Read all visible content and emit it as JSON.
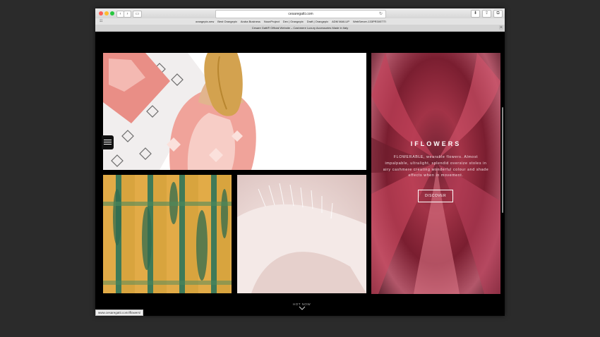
{
  "browser": {
    "url": "cesaregatti.com",
    "bookmarks": [
      "orangepix-new",
      "Best Orangepix",
      "Aruba Business",
      "NounProject",
      "Dev | Orangepix",
      "Draft | Orangepix",
      "ADM MAILUP",
      "WebServer-133PR3XETTI"
    ],
    "tab_title": "Cesare Gatti® Official Website – Cashmere Luxury Accessories Made in Italy",
    "status_url": "www.cesaregatti.com/iflowers/"
  },
  "collections": {
    "iflowers": {
      "title": "IFLOWERS",
      "description": "FLOWERABLE, wearable flowers. Almost impalpable, ultralight, splendid oversize stoles in airy cashmere creating wonderful colour and shade effects when in movement.",
      "cta": "DISCOVER"
    }
  },
  "footer": {
    "hot_now": "HOT NOW"
  },
  "icons": {
    "menu": "hamburger-menu-icon",
    "scroll": "chevron-down-icon"
  },
  "colors": {
    "page_bg": "#000000",
    "desktop_bg": "#2b2b2b",
    "flowers_accent": "#a23347"
  }
}
